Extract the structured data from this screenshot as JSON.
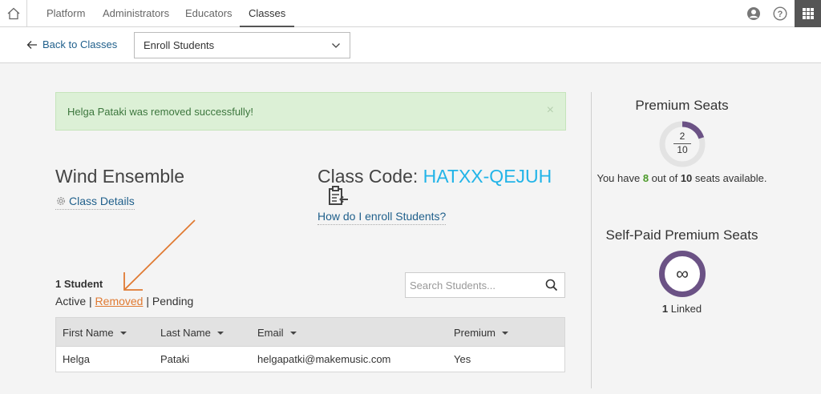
{
  "nav": {
    "tabs": [
      {
        "label": "Platform"
      },
      {
        "label": "Administrators"
      },
      {
        "label": "Educators"
      },
      {
        "label": "Classes"
      }
    ]
  },
  "subbar": {
    "back_label": "Back to Classes",
    "select_value": "Enroll Students"
  },
  "alert": {
    "message": "Helga Pataki was removed successfully!",
    "close": "×"
  },
  "class": {
    "name": "Wind Ensemble",
    "details_link": "Class Details",
    "code_label": "Class Code: ",
    "code_value": "HATXX-QEJUH",
    "enroll_help": "How do I enroll Students?"
  },
  "students": {
    "count": "1 Student",
    "filter_active": "Active",
    "filter_sep": " | ",
    "filter_removed": "Removed",
    "filter_pending": "Pending",
    "search_placeholder": "Search Students..."
  },
  "table": {
    "headers": [
      "First Name",
      "Last Name",
      "Email",
      "Premium"
    ],
    "rows": [
      {
        "first": "Helga",
        "last": "Pataki",
        "email": "helgapatki@makemusic.com",
        "premium": "Yes"
      }
    ]
  },
  "premium": {
    "title": "Premium Seats",
    "used": "2",
    "total": "10",
    "used_fraction": 0.2,
    "text_prefix": "You have ",
    "available": "8",
    "text_mid": " out of ",
    "total_bold": "10",
    "text_suffix": " seats available."
  },
  "self_paid": {
    "title": "Self-Paid Premium Seats",
    "symbol": "∞",
    "linked_count": "1",
    "linked_label": " Linked"
  },
  "colors": {
    "accent_code": "#22b4e8",
    "link": "#1f5f8b",
    "success_bg": "#dcf0d6",
    "donut_purple": "#6b5285",
    "arrow_orange": "#e07a32"
  }
}
